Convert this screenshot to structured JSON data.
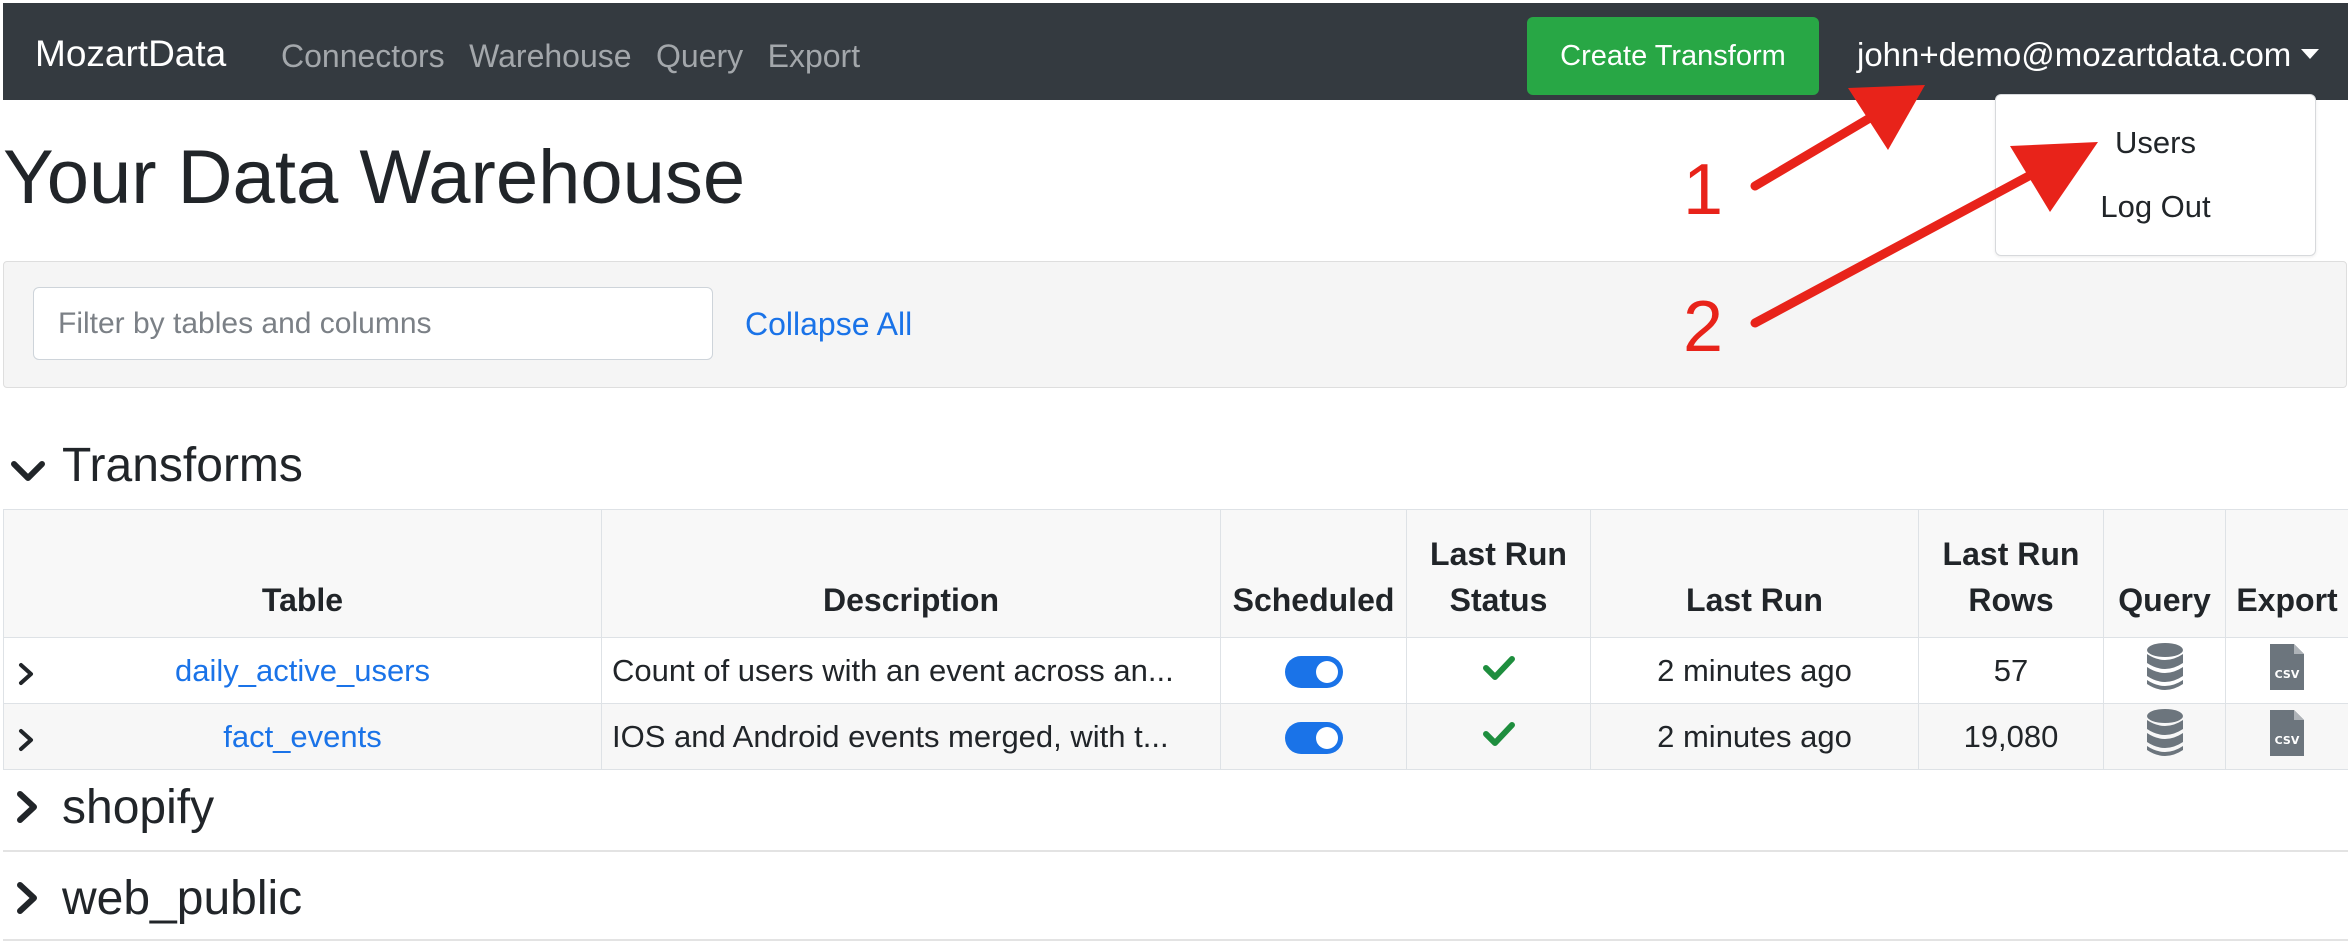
{
  "navbar": {
    "brand": "MozartData",
    "links": [
      "Connectors",
      "Warehouse",
      "Query",
      "Export"
    ],
    "create_button": "Create Transform",
    "user_email": "john+demo@mozartdata.com"
  },
  "user_dropdown": {
    "items": [
      "Users",
      "Log Out"
    ]
  },
  "page_title": "Your Data Warehouse",
  "filter": {
    "placeholder": "Filter by tables and columns",
    "value": "",
    "collapse_all": "Collapse All"
  },
  "sections": [
    {
      "title": "Transforms",
      "expanded": true
    },
    {
      "title": "shopify",
      "expanded": false
    },
    {
      "title": "web_public",
      "expanded": false
    }
  ],
  "transforms_table": {
    "headers": [
      "Table",
      "Description",
      "Scheduled",
      "Last Run Status",
      "Last Run",
      "Last Run Rows",
      "Query",
      "Export"
    ],
    "rows": [
      {
        "table": "daily_active_users",
        "description": "Count of users with an event across an...",
        "scheduled": true,
        "last_run_status": "success",
        "last_run": "2 minutes ago",
        "last_run_rows": "57"
      },
      {
        "table": "fact_events",
        "description": "IOS and Android events merged, with t...",
        "scheduled": true,
        "last_run_status": "success",
        "last_run": "2 minutes ago",
        "last_run_rows": "19,080"
      }
    ]
  },
  "icons": {
    "query": "database-icon",
    "export": "csv-file-icon",
    "status": "check-icon"
  },
  "annotations": [
    "1",
    "2"
  ],
  "colors": {
    "navbar": "#343a40",
    "create_button": "#28a745",
    "link": "#1a73e8",
    "toggle": "#1a73e8",
    "check": "#1e8e3e",
    "annotation": "#e8231a"
  }
}
